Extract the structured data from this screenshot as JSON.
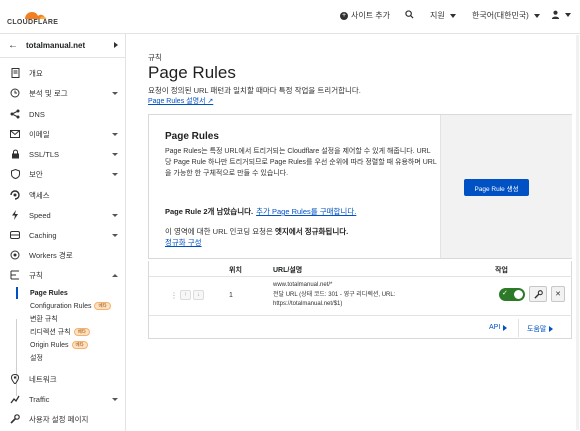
{
  "topbar": {
    "brand": "CLOUDFLARE",
    "add_site": "사이트 추가",
    "support": "지원",
    "language": "한국어(대한민국)",
    "account_icon": "user-icon"
  },
  "sidebar": {
    "domain": "totalmanual.net",
    "items": [
      {
        "label": "개요",
        "icon": "document-icon"
      },
      {
        "label": "분석 및 로그",
        "icon": "clock-icon"
      },
      {
        "label": "DNS",
        "icon": "dns-icon"
      },
      {
        "label": "이메일",
        "icon": "mail-icon"
      },
      {
        "label": "SSL/TLS",
        "icon": "lock-icon"
      },
      {
        "label": "보안",
        "icon": "shield-icon"
      },
      {
        "label": "액세스",
        "icon": "access-icon"
      },
      {
        "label": "Speed",
        "icon": "bolt-icon"
      },
      {
        "label": "Caching",
        "icon": "drive-icon"
      },
      {
        "label": "Workers 경로",
        "icon": "workers-icon"
      },
      {
        "label": "규칙",
        "icon": "rules-icon"
      },
      {
        "label": "네트워크",
        "icon": "pin-icon"
      },
      {
        "label": "Traffic",
        "icon": "traffic-icon"
      },
      {
        "label": "사용자 설정 페이지",
        "icon": "wrench-icon"
      }
    ],
    "rules_sub": [
      {
        "label": "Page Rules",
        "beta": ""
      },
      {
        "label": "Configuration Rules",
        "beta": "베타"
      },
      {
        "label": "변환 규칙",
        "beta": ""
      },
      {
        "label": "리디렉션 규칙",
        "beta": "베타"
      },
      {
        "label": "Origin Rules",
        "beta": "베타"
      },
      {
        "label": "설정",
        "beta": ""
      }
    ]
  },
  "main": {
    "eyebrow": "규칙",
    "title": "Page Rules",
    "description": "요청이 정의된 URL 패턴과 일치할 때마다 특정 작업을 트리거합니다.",
    "doc_link": "Page Rules 설명서 ↗",
    "card": {
      "title": "Page Rules",
      "body": "Page Rules는 특정 URL에서 트리거되는 Cloudflare 설정을 제어할 수 있게 해줍니다. URL당 Page Rule 하나만 트리거되므로 Page Rules를 우선 순위에 따라 정렬할 때 유용하며 URL을 가능한 한 구체적으로 만들 수 있습니다.",
      "remaining": "Page Rule 2개 남았습니다.",
      "purchase": "추가 Page Rules를 구매합니다.",
      "normalize_prefix": "이 영역에 대한 URL 인코딩 요청은 ",
      "normalize_bold": "엣지에서 정규화됩니다.",
      "normalize_link": "정규화 구성",
      "create_button": "Page Rule 생성"
    },
    "table": {
      "headers": {
        "position": "위치",
        "url": "URL/설명",
        "action": "작업"
      },
      "rows": [
        {
          "position": "1",
          "url": "www.totalmanual.net/*",
          "description_line1": "전달 URL (상태 코드: 301 - 영구 리디렉션, URL:",
          "description_line2": "https://totalmanual.net/$1)",
          "enabled": true
        }
      ],
      "api_link": "API",
      "help_link": "도움말"
    }
  }
}
